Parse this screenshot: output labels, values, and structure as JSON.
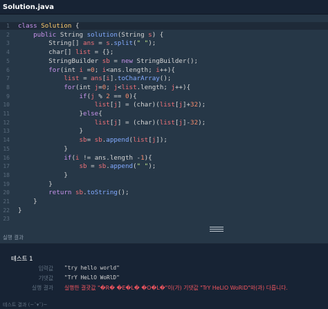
{
  "tab": {
    "filename": "Solution.java"
  },
  "editor": {
    "lines": [
      {
        "n": "1",
        "tokens": [
          [
            "kw",
            "class "
          ],
          [
            "cls",
            "Solution"
          ],
          [
            "plain",
            " {"
          ]
        ]
      },
      {
        "n": "2",
        "tokens": [
          [
            "plain",
            "    "
          ],
          [
            "kw",
            "public "
          ],
          [
            "plain",
            "String "
          ],
          [
            "fn",
            "solution"
          ],
          [
            "plain",
            "(String "
          ],
          [
            "id",
            "s"
          ],
          [
            "plain",
            ") {"
          ]
        ]
      },
      {
        "n": "3",
        "tokens": [
          [
            "plain",
            "        String[] "
          ],
          [
            "id",
            "ans"
          ],
          [
            "plain",
            " = "
          ],
          [
            "id",
            "s"
          ],
          [
            "plain",
            "."
          ],
          [
            "fn",
            "split"
          ],
          [
            "plain",
            "("
          ],
          [
            "str",
            "\" \""
          ],
          [
            "plain",
            ");"
          ]
        ]
      },
      {
        "n": "4",
        "tokens": [
          [
            "plain",
            "        char[] "
          ],
          [
            "id",
            "list"
          ],
          [
            "plain",
            " = {};"
          ]
        ]
      },
      {
        "n": "5",
        "tokens": [
          [
            "plain",
            "        StringBuilder "
          ],
          [
            "id",
            "sb"
          ],
          [
            "plain",
            " = "
          ],
          [
            "kw",
            "new "
          ],
          [
            "plain",
            "StringBuilder();"
          ]
        ]
      },
      {
        "n": "6",
        "tokens": [
          [
            "plain",
            "        "
          ],
          [
            "kw",
            "for"
          ],
          [
            "plain",
            "(int "
          ],
          [
            "id",
            "i"
          ],
          [
            "plain",
            " ="
          ],
          [
            "num",
            "0"
          ],
          [
            "plain",
            "; "
          ],
          [
            "id",
            "i"
          ],
          [
            "plain",
            "<ans.length; "
          ],
          [
            "id",
            "i"
          ],
          [
            "plain",
            "++){"
          ]
        ]
      },
      {
        "n": "7",
        "tokens": [
          [
            "plain",
            "            "
          ],
          [
            "id",
            "list"
          ],
          [
            "plain",
            " = "
          ],
          [
            "id",
            "ans"
          ],
          [
            "plain",
            "["
          ],
          [
            "id",
            "i"
          ],
          [
            "plain",
            "]."
          ],
          [
            "fn",
            "toCharArray"
          ],
          [
            "plain",
            "();"
          ]
        ]
      },
      {
        "n": "8",
        "tokens": [
          [
            "plain",
            "            "
          ],
          [
            "kw",
            "for"
          ],
          [
            "plain",
            "(int "
          ],
          [
            "id",
            "j"
          ],
          [
            "plain",
            "="
          ],
          [
            "num",
            "0"
          ],
          [
            "plain",
            "; "
          ],
          [
            "id",
            "j"
          ],
          [
            "plain",
            "<"
          ],
          [
            "id",
            "list"
          ],
          [
            "plain",
            ".length; "
          ],
          [
            "id",
            "j"
          ],
          [
            "plain",
            "++){"
          ]
        ]
      },
      {
        "n": "9",
        "tokens": [
          [
            "plain",
            "                "
          ],
          [
            "kw",
            "if"
          ],
          [
            "plain",
            "("
          ],
          [
            "id",
            "j"
          ],
          [
            "plain",
            " % "
          ],
          [
            "num",
            "2"
          ],
          [
            "plain",
            " == "
          ],
          [
            "num",
            "0"
          ],
          [
            "plain",
            "){"
          ]
        ]
      },
      {
        "n": "10",
        "tokens": [
          [
            "plain",
            "                    "
          ],
          [
            "id",
            "list"
          ],
          [
            "plain",
            "["
          ],
          [
            "id",
            "j"
          ],
          [
            "plain",
            "] = (char)("
          ],
          [
            "id",
            "list"
          ],
          [
            "plain",
            "["
          ],
          [
            "id",
            "j"
          ],
          [
            "plain",
            "]+"
          ],
          [
            "num",
            "32"
          ],
          [
            "plain",
            ");"
          ]
        ]
      },
      {
        "n": "11",
        "tokens": [
          [
            "plain",
            "                }"
          ],
          [
            "kw",
            "else"
          ],
          [
            "plain",
            "{"
          ]
        ]
      },
      {
        "n": "12",
        "tokens": [
          [
            "plain",
            "                    "
          ],
          [
            "id",
            "list"
          ],
          [
            "plain",
            "["
          ],
          [
            "id",
            "j"
          ],
          [
            "plain",
            "] = (char)("
          ],
          [
            "id",
            "list"
          ],
          [
            "plain",
            "["
          ],
          [
            "id",
            "j"
          ],
          [
            "plain",
            "]-"
          ],
          [
            "num",
            "32"
          ],
          [
            "plain",
            ");"
          ]
        ]
      },
      {
        "n": "13",
        "tokens": [
          [
            "plain",
            "                }"
          ]
        ]
      },
      {
        "n": "14",
        "tokens": [
          [
            "plain",
            "                "
          ],
          [
            "id",
            "sb"
          ],
          [
            "plain",
            "= "
          ],
          [
            "id",
            "sb"
          ],
          [
            "plain",
            "."
          ],
          [
            "fn",
            "append"
          ],
          [
            "plain",
            "("
          ],
          [
            "id",
            "list"
          ],
          [
            "plain",
            "["
          ],
          [
            "id",
            "j"
          ],
          [
            "plain",
            "]);"
          ]
        ]
      },
      {
        "n": "15",
        "tokens": [
          [
            "plain",
            "            }"
          ]
        ]
      },
      {
        "n": "16",
        "tokens": [
          [
            "plain",
            "            "
          ],
          [
            "kw",
            "if"
          ],
          [
            "plain",
            "("
          ],
          [
            "id",
            "i"
          ],
          [
            "plain",
            " != ans.length -"
          ],
          [
            "num",
            "1"
          ],
          [
            "plain",
            ")"
          ],
          [
            "plain",
            "{"
          ]
        ]
      },
      {
        "n": "17",
        "tokens": [
          [
            "plain",
            "                "
          ],
          [
            "id",
            "sb"
          ],
          [
            "plain",
            " = "
          ],
          [
            "id",
            "sb"
          ],
          [
            "plain",
            "."
          ],
          [
            "fn",
            "append"
          ],
          [
            "plain",
            "("
          ],
          [
            "str",
            "\" \""
          ],
          [
            "plain",
            ");"
          ]
        ]
      },
      {
        "n": "18",
        "tokens": [
          [
            "plain",
            "            }"
          ]
        ]
      },
      {
        "n": "19",
        "tokens": [
          [
            "plain",
            "        }"
          ]
        ]
      },
      {
        "n": "20",
        "tokens": [
          [
            "plain",
            "        "
          ],
          [
            "kw",
            "return "
          ],
          [
            "id",
            "sb"
          ],
          [
            "plain",
            "."
          ],
          [
            "fn",
            "toString"
          ],
          [
            "plain",
            "();"
          ]
        ]
      },
      {
        "n": "21",
        "tokens": [
          [
            "plain",
            "    }"
          ]
        ]
      },
      {
        "n": "22",
        "tokens": [
          [
            "plain",
            "}"
          ]
        ]
      },
      {
        "n": "23",
        "tokens": []
      }
    ]
  },
  "result": {
    "header": "실행 결과",
    "test_title": "테스트 1",
    "rows": [
      {
        "key": "입력값",
        "value": "\"try hello world\""
      },
      {
        "key": "기댓값",
        "value": "\"TrY HeLlO WoRlD\""
      },
      {
        "key": "실행 결과",
        "value": "실행한 결괏값 \"�R� �E�L� �O�L�\"이(가) 기댓값 \"TrY HeLlO WoRlD\"와(과) 다릅니다.",
        "fail": true
      }
    ]
  },
  "bottom": {
    "text": "테스트 결과 (~˘▾˘)~"
  }
}
